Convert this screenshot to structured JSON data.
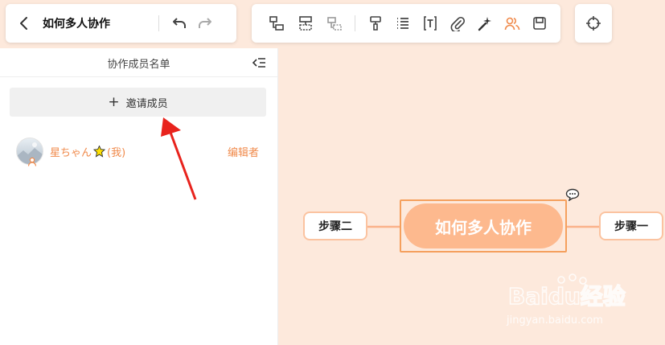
{
  "header": {
    "doc_title": "如何多人协作"
  },
  "sidebar": {
    "title": "协作成员名单",
    "invite_label": "邀请成员",
    "members": [
      {
        "name": "星ちゃん",
        "self_tag": "(我)",
        "role": "编辑者"
      }
    ]
  },
  "mindmap": {
    "root": "如何多人协作",
    "left": "步骤二",
    "right": "步骤一"
  },
  "watermark": {
    "brand": "Baidu经验",
    "url": "jingyan.baidu.com"
  },
  "colors": {
    "accent": "#f08a4b",
    "root_fill": "#fdb98e",
    "canvas": "#fde9dc",
    "arrow": "#e8231d"
  },
  "icons": {
    "toolbar": [
      "back-icon",
      "undo-icon",
      "redo-icon",
      "child-topic-icon",
      "sibling-topic-icon",
      "parent-topic-icon",
      "format-painter-icon",
      "list-icon",
      "text-frame-icon",
      "attachment-icon",
      "magic-wand-icon",
      "collaborators-icon",
      "save-icon",
      "locate-icon"
    ]
  }
}
